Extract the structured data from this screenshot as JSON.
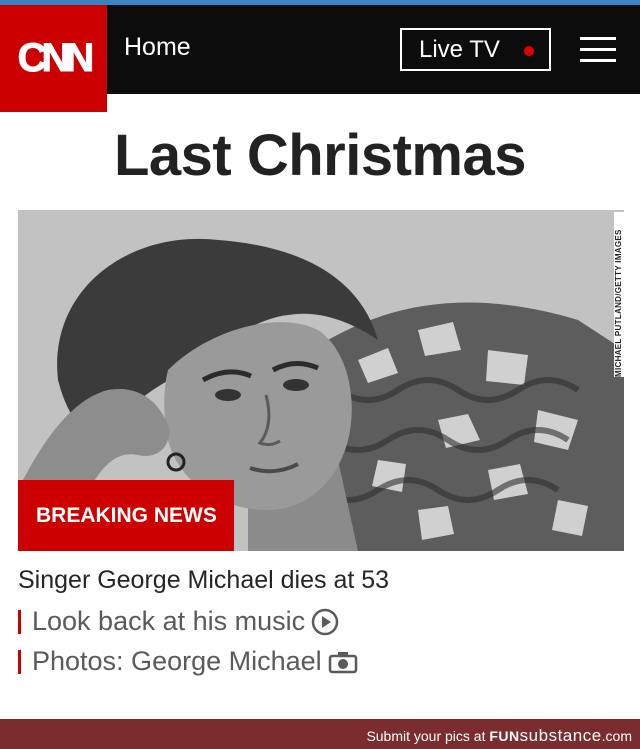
{
  "nav": {
    "logo_text": "CNN",
    "home_label": "Home",
    "live_label": "Live TV",
    "menu_icon": "hamburger-menu-icon"
  },
  "page": {
    "headline": "Last Christmas"
  },
  "hero": {
    "photo_credit": "MICHAEL PUTLAND/GETTY IMAGES",
    "badge": "BREAKING NEWS"
  },
  "story": {
    "title": "Singer George Michael dies at 53",
    "links": [
      {
        "label": "Look back at his music",
        "icon": "play-icon"
      },
      {
        "label": "Photos: George Michael",
        "icon": "camera-icon"
      }
    ]
  },
  "footer": {
    "text": "Submit your pics at ",
    "brand_prefix": "FUN",
    "brand_suffix": "substance",
    "brand_domain": ".com"
  },
  "colors": {
    "cnn_red": "#cc0000",
    "nav_black": "#0c0c0c",
    "footer_bg": "#7a2c2f"
  }
}
